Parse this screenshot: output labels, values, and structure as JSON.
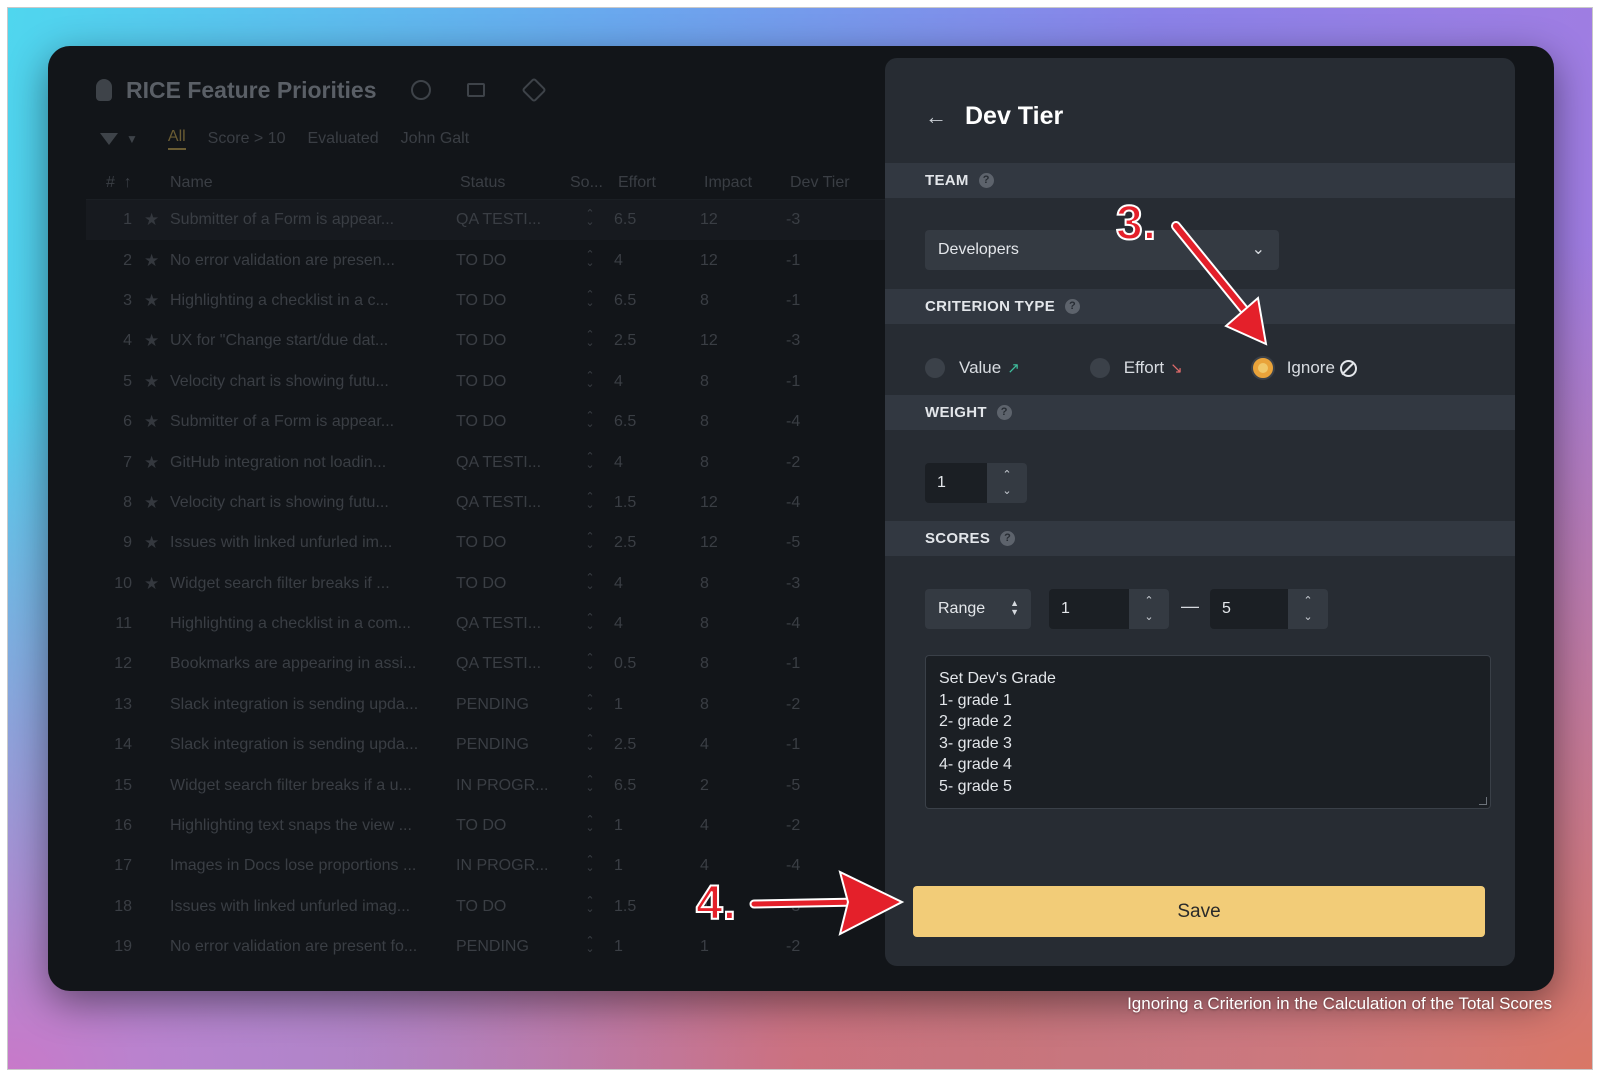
{
  "app": {
    "title": "RICE Feature Priorities",
    "filter_tabs": [
      "All",
      "Score > 10",
      "Evaluated",
      "John Galt"
    ],
    "active_tab": "All"
  },
  "table": {
    "headers": {
      "num": "#",
      "name": "Name",
      "status": "Status",
      "score": "So...",
      "effort": "Effort",
      "impact": "Impact",
      "dev_tier": "Dev Tier"
    },
    "rows": [
      {
        "num": "1",
        "starred": true,
        "name": "Submitter of a Form is appear...",
        "status": "QA TESTI...",
        "effort": "6.5",
        "impact": "12",
        "dev": "-3"
      },
      {
        "num": "2",
        "starred": true,
        "name": "No error validation are presen...",
        "status": "TO DO",
        "effort": "4",
        "impact": "12",
        "dev": "-1"
      },
      {
        "num": "3",
        "starred": true,
        "name": "Highlighting a checklist in a c...",
        "status": "TO DO",
        "effort": "6.5",
        "impact": "8",
        "dev": "-1"
      },
      {
        "num": "4",
        "starred": true,
        "name": "UX for \"Change start/due dat...",
        "status": "TO DO",
        "effort": "2.5",
        "impact": "12",
        "dev": "-3"
      },
      {
        "num": "5",
        "starred": true,
        "name": "Velocity chart is showing futu...",
        "status": "TO DO",
        "effort": "4",
        "impact": "8",
        "dev": "-1"
      },
      {
        "num": "6",
        "starred": true,
        "name": "Submitter of a Form is appear...",
        "status": "TO DO",
        "effort": "6.5",
        "impact": "8",
        "dev": "-4"
      },
      {
        "num": "7",
        "starred": true,
        "name": "GitHub integration not loadin...",
        "status": "QA TESTI...",
        "effort": "4",
        "impact": "8",
        "dev": "-2"
      },
      {
        "num": "8",
        "starred": true,
        "name": "Velocity chart is showing futu...",
        "status": "QA TESTI...",
        "effort": "1.5",
        "impact": "12",
        "dev": "-4"
      },
      {
        "num": "9",
        "starred": true,
        "name": "Issues with linked unfurled im...",
        "status": "TO DO",
        "effort": "2.5",
        "impact": "12",
        "dev": "-5"
      },
      {
        "num": "10",
        "starred": true,
        "name": "Widget search filter breaks if ...",
        "status": "TO DO",
        "effort": "4",
        "impact": "8",
        "dev": "-3"
      },
      {
        "num": "11",
        "starred": false,
        "name": "Highlighting a checklist in a com...",
        "status": "QA TESTI...",
        "effort": "4",
        "impact": "8",
        "dev": "-4"
      },
      {
        "num": "12",
        "starred": false,
        "name": "Bookmarks are appearing in assi...",
        "status": "QA TESTI...",
        "effort": "0.5",
        "impact": "8",
        "dev": "-1"
      },
      {
        "num": "13",
        "starred": false,
        "name": "Slack integration is sending upda...",
        "status": "PENDING",
        "effort": "1",
        "impact": "8",
        "dev": "-2"
      },
      {
        "num": "14",
        "starred": false,
        "name": "Slack integration is sending upda...",
        "status": "PENDING",
        "effort": "2.5",
        "impact": "4",
        "dev": "-1"
      },
      {
        "num": "15",
        "starred": false,
        "name": "Widget search filter breaks if a u...",
        "status": "IN PROGR...",
        "effort": "6.5",
        "impact": "2",
        "dev": "-5"
      },
      {
        "num": "16",
        "starred": false,
        "name": "Highlighting text snaps the view ...",
        "status": "TO DO",
        "effort": "1",
        "impact": "4",
        "dev": "-2"
      },
      {
        "num": "17",
        "starred": false,
        "name": "Images in Docs lose proportions ...",
        "status": "IN PROGR...",
        "effort": "1",
        "impact": "4",
        "dev": "-4"
      },
      {
        "num": "18",
        "starred": false,
        "name": "Issues with linked unfurled imag...",
        "status": "TO DO",
        "effort": "1.5",
        "impact": "4",
        "dev": "-3"
      },
      {
        "num": "19",
        "starred": false,
        "name": "No error validation are present fo...",
        "status": "PENDING",
        "effort": "1",
        "impact": "1",
        "dev": "-2"
      }
    ]
  },
  "panel": {
    "title": "Dev Tier",
    "team_label": "TEAM",
    "team_value": "Developers",
    "criterion_label": "CRITERION TYPE",
    "criterion_options": [
      "Value",
      "Effort",
      "Ignore"
    ],
    "criterion_selected": "Ignore",
    "weight_label": "WEIGHT",
    "weight_value": "1",
    "scores_label": "SCORES",
    "scores_mode": "Range",
    "range_min": "1",
    "range_max": "5",
    "range_separator": "—",
    "scores_description": [
      "Set Dev's Grade",
      "1- grade 1",
      "2- grade 2",
      "3- grade 3",
      "4- grade 4",
      "5- grade 5"
    ],
    "save_label": "Save",
    "help_glyph": "?"
  },
  "annotations": {
    "step3": "3.",
    "step4": "4.",
    "color": "#e4202a"
  },
  "caption": "Ignoring a Criterion in the Calculation of the Total Scores",
  "colors": {
    "accent": "#f2cc78",
    "panel_bg": "#272c33",
    "app_bg": "#121519"
  }
}
